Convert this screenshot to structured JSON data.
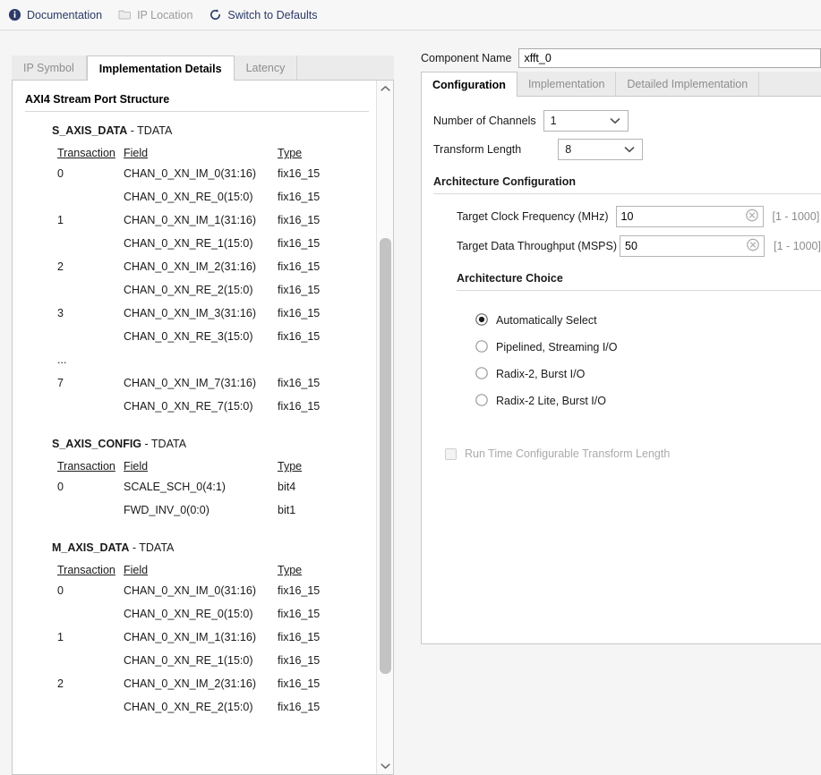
{
  "toolbar": {
    "items": [
      {
        "label": "Documentation",
        "icon": "info-icon",
        "disabled": false
      },
      {
        "label": "IP Location",
        "icon": "folder-icon",
        "disabled": true
      },
      {
        "label": "Switch to Defaults",
        "icon": "refresh-icon",
        "disabled": false
      }
    ]
  },
  "left_panel": {
    "tabs": [
      {
        "label": "IP Symbol",
        "active": false
      },
      {
        "label": "Implementation Details",
        "active": true
      },
      {
        "label": "Latency",
        "active": false
      }
    ],
    "section_title": "AXI4 Stream Port Structure",
    "columns": [
      "Transaction",
      "Field",
      "Type"
    ],
    "groups": [
      {
        "name": "S_AXIS_DATA",
        "suffix": " - TDATA",
        "rows": [
          {
            "transaction": "0",
            "field": "CHAN_0_XN_IM_0(31:16)",
            "type": "fix16_15"
          },
          {
            "transaction": "",
            "field": "CHAN_0_XN_RE_0(15:0)",
            "type": "fix16_15"
          },
          {
            "transaction": "1",
            "field": "CHAN_0_XN_IM_1(31:16)",
            "type": "fix16_15"
          },
          {
            "transaction": "",
            "field": "CHAN_0_XN_RE_1(15:0)",
            "type": "fix16_15"
          },
          {
            "transaction": "2",
            "field": "CHAN_0_XN_IM_2(31:16)",
            "type": "fix16_15"
          },
          {
            "transaction": "",
            "field": "CHAN_0_XN_RE_2(15:0)",
            "type": "fix16_15"
          },
          {
            "transaction": "3",
            "field": "CHAN_0_XN_IM_3(31:16)",
            "type": "fix16_15"
          },
          {
            "transaction": "",
            "field": "CHAN_0_XN_RE_3(15:0)",
            "type": "fix16_15"
          },
          {
            "transaction": "...",
            "field": "",
            "type": ""
          },
          {
            "transaction": "7",
            "field": "CHAN_0_XN_IM_7(31:16)",
            "type": "fix16_15"
          },
          {
            "transaction": "",
            "field": "CHAN_0_XN_RE_7(15:0)",
            "type": "fix16_15"
          }
        ]
      },
      {
        "name": "S_AXIS_CONFIG",
        "suffix": " - TDATA",
        "rows": [
          {
            "transaction": "0",
            "field": "SCALE_SCH_0(4:1)",
            "type": "bit4"
          },
          {
            "transaction": "",
            "field": "FWD_INV_0(0:0)",
            "type": "bit1"
          }
        ]
      },
      {
        "name": "M_AXIS_DATA",
        "suffix": " - TDATA",
        "rows": [
          {
            "transaction": "0",
            "field": "CHAN_0_XN_IM_0(31:16)",
            "type": "fix16_15"
          },
          {
            "transaction": "",
            "field": "CHAN_0_XN_RE_0(15:0)",
            "type": "fix16_15"
          },
          {
            "transaction": "1",
            "field": "CHAN_0_XN_IM_1(31:16)",
            "type": "fix16_15"
          },
          {
            "transaction": "",
            "field": "CHAN_0_XN_RE_1(15:0)",
            "type": "fix16_15"
          },
          {
            "transaction": "2",
            "field": "CHAN_0_XN_IM_2(31:16)",
            "type": "fix16_15"
          },
          {
            "transaction": "",
            "field": "CHAN_0_XN_RE_2(15:0)",
            "type": "fix16_15"
          }
        ]
      }
    ]
  },
  "right_panel": {
    "component_name_label": "Component Name",
    "component_name_value": "xfft_0",
    "tabs": [
      {
        "label": "Configuration",
        "active": true
      },
      {
        "label": "Implementation",
        "active": false
      },
      {
        "label": "Detailed Implementation",
        "active": false
      }
    ],
    "fields": {
      "channels_label": "Number of Channels",
      "channels_value": "1",
      "transform_label": "Transform Length",
      "transform_value": "8"
    },
    "architecture_configuration": {
      "title": "Architecture Configuration",
      "clock_label": "Target Clock Frequency (MHz)",
      "clock_value": "10",
      "clock_range": "[1 - 1000]",
      "throughput_label": "Target Data Throughput (MSPS)",
      "throughput_value": "50",
      "throughput_range": "[1 - 1000]"
    },
    "architecture_choice": {
      "title": "Architecture Choice",
      "options": [
        {
          "label": "Automatically Select",
          "selected": true
        },
        {
          "label": "Pipelined, Streaming I/O",
          "selected": false
        },
        {
          "label": "Radix-2, Burst I/O",
          "selected": false
        },
        {
          "label": "Radix-2 Lite, Burst I/O",
          "selected": false
        }
      ]
    },
    "runtime_checkbox": {
      "label": "Run Time Configurable Transform Length",
      "checked": false,
      "disabled": true
    }
  },
  "colors": {
    "link_text": "#2b3a67",
    "disabled_text": "#9a9a9a",
    "panel_bg": "#f5f5f5",
    "content_bg": "#ffffff",
    "border": "#c8c8c8",
    "scroll_thumb": "#c3c3c3"
  }
}
